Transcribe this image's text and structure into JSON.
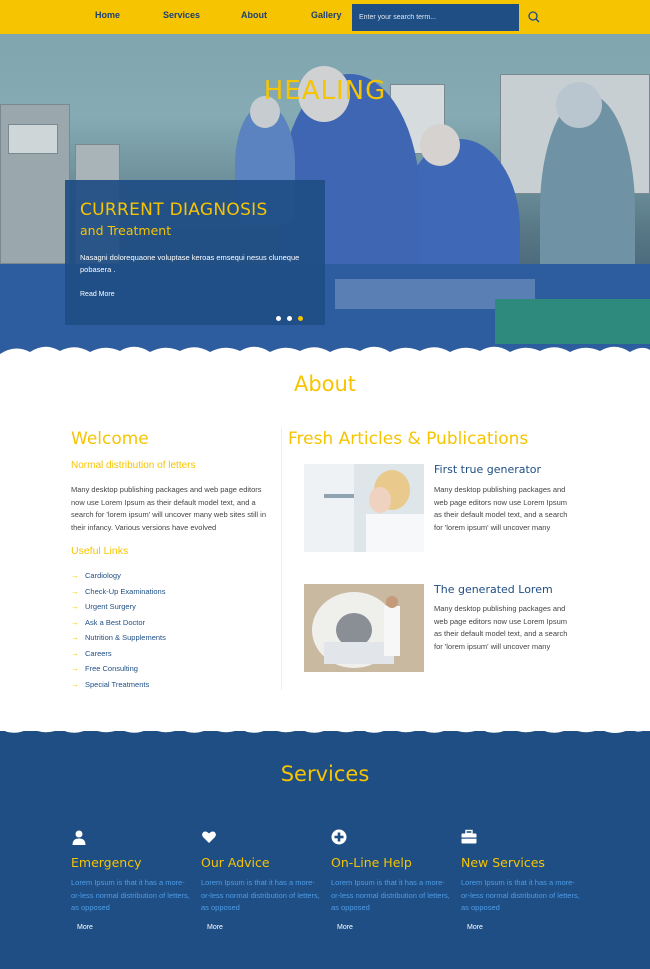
{
  "nav": {
    "items": [
      "Home",
      "Services",
      "About",
      "Gallery"
    ],
    "search_placeholder": "Enter your search term...",
    "search_icon": "search-icon"
  },
  "hero": {
    "title": "HEALING",
    "caption_title": "CURRENT DIAGNOSIS",
    "caption_subtitle": "and Treatment",
    "caption_text": "Nasagni dolorequaone voluptase keroas emsequi nesus cluneque pobasera .",
    "more_label": "Read More",
    "slides": 3,
    "active_slide": 3
  },
  "about": {
    "title": "About",
    "welcome_title": "Welcome",
    "welcome_subtitle": "Normal distribution of letters",
    "welcome_text": "Many desktop publishing packages and web page editors now use Lorem Ipsum as their default model text, and a search for 'lorem ipsum' will uncover many web sites still in their infancy. Various versions have evolved",
    "useful_title": "Useful Links",
    "links": [
      "Cardiology",
      "Check-Up Examinations",
      "Urgent Surgery",
      "Ask a Best Doctor",
      "Nutrition & Supplements",
      "Careers",
      "Free Consulting",
      "Special Treatments"
    ],
    "fresh_title": "Fresh Articles & Publications",
    "articles": [
      {
        "title": "First true generator",
        "text": "Many desktop publishing packages and web page editors now use Lorem Ipsum as their default model text, and a search for 'lorem ipsum' will uncover many"
      },
      {
        "title": "The generated Lorem",
        "text": "Many desktop publishing packages and web page editors now use Lorem Ipsum as their default model text, and a search for 'lorem ipsum' will uncover many"
      }
    ]
  },
  "services": {
    "title": "Services",
    "items": [
      {
        "icon": "user-icon",
        "title": "Emergency",
        "text": "Lorem Ipsum is that it has a more-or-less normal distribution of letters, as opposed",
        "more": "More"
      },
      {
        "icon": "heart-icon",
        "title": "Our Advice",
        "text": "Lorem Ipsum is that it has a more-or-less normal distribution of letters, as opposed",
        "more": "More"
      },
      {
        "icon": "plus-circle-icon",
        "title": "On-Line Help",
        "text": "Lorem Ipsum is that it has a more-or-less normal distribution of letters, as opposed",
        "more": "More"
      },
      {
        "icon": "briefcase-icon",
        "title": "New Services",
        "text": "Lorem Ipsum is that it has a more-or-less normal distribution of letters, as opposed",
        "more": "More"
      }
    ]
  },
  "colors": {
    "accent": "#f6c400",
    "primary": "#1f4e84",
    "service_text": "#4f9de6"
  }
}
